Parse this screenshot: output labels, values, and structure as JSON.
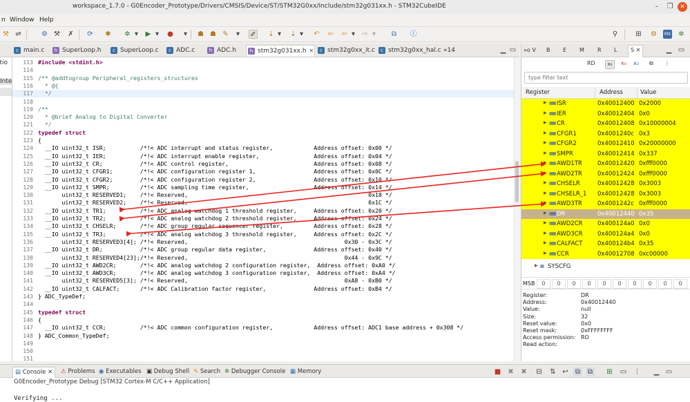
{
  "window": {
    "title": "workspace_1.7.0 - G0Encoder_Prototype/Drivers/CMSIS/Device/ST/STM32G0xx/Include/stm32g031xx.h - STM32CubeIDE",
    "min": "–",
    "max": "❐",
    "close": "✕"
  },
  "menu": {
    "items": [
      "n",
      "Window",
      "Help"
    ]
  },
  "toolbar": {
    "icons": [
      "wrench-icon",
      "debug-config-icon",
      "build-icon",
      "debug-icon",
      "run-icon",
      "external-tools-icon",
      "pin-icon",
      "step-icon",
      "back-icon",
      "forward-icon",
      "info-icon",
      "search-icon",
      "perspective-icon"
    ]
  },
  "editor_tabs": [
    {
      "label": "main.c",
      "icon_color": "#3a6ea5",
      "icon": "c"
    },
    {
      "label": "SuperLoop.h",
      "icon_color": "#8a6bb5",
      "icon": "h"
    },
    {
      "label": "SuperLoop.c",
      "icon_color": "#3a6ea5",
      "icon": "c"
    },
    {
      "label": "ADC.c",
      "icon_color": "#3a6ea5",
      "icon": "c"
    },
    {
      "label": "ADC.h",
      "icon_color": "#8a6bb5",
      "icon": "h"
    },
    {
      "label": "stm32g031xx.h",
      "icon_color": "#8a6bb5",
      "icon": "h",
      "close": "✕"
    },
    {
      "label": "stm32g0xx_it.c",
      "icon_color": "#3a6ea5",
      "icon": "c"
    },
    {
      "label": "stm32g0xx_hal.c",
      "icon_color": "#3a6ea5",
      "icon": "c"
    },
    {
      "label": "»14",
      "icon_color": "",
      "icon": ""
    }
  ],
  "left_panel": {
    "lines": [
      "atio",
      "Inte"
    ]
  },
  "code": [
    {
      "n": "113",
      "t": "#include <stdint.h>",
      "c": "include"
    },
    {
      "n": "114",
      "t": "",
      "c": ""
    },
    {
      "n": "115",
      "t": "/** @addtogroup Peripheral_registers_structures",
      "c": "comment"
    },
    {
      "n": "116",
      "t": "  * @{",
      "c": "comment"
    },
    {
      "n": "117",
      "t": "  */",
      "c": "comment"
    },
    {
      "n": "118",
      "t": "",
      "c": ""
    },
    {
      "n": "119",
      "t": "/**",
      "c": "comment"
    },
    {
      "n": "120",
      "t": "  * @brief Analog to Digital Converter",
      "c": "comment"
    },
    {
      "n": "121",
      "t": "  */",
      "c": "comment"
    },
    {
      "n": "122",
      "t": "typedef struct",
      "c": "keyword"
    },
    {
      "n": "123",
      "t": "{",
      "c": ""
    },
    {
      "n": "124",
      "t": "  __IO uint32_t ISR;          /*!< ADC interrupt and status register,            Address offset: 0x00 */",
      "c": ""
    },
    {
      "n": "125",
      "t": "  __IO uint32_t IER;          /*!< ADC interrupt enable register,                Address offset: 0x04 */",
      "c": ""
    },
    {
      "n": "126",
      "t": "  __IO uint32_t CR;           /*!< ADC control register,                         Address offset: 0x08 */",
      "c": ""
    },
    {
      "n": "127",
      "t": "  __IO uint32_t CFGR1;        /*!< ADC configuration register 1,                 Address offset: 0x0C */",
      "c": ""
    },
    {
      "n": "128",
      "t": "  __IO uint32_t CFGR2;        /*!< ADC configuration register 2,                 Address offset: 0x10 */",
      "c": ""
    },
    {
      "n": "129",
      "t": "  __IO uint32_t SMPR;         /*!< ADC sampling time register,                   Address offset: 0x14 */",
      "c": ""
    },
    {
      "n": "130",
      "t": "       uint32_t RESERVED1;    /*!< Reserved,                                                     0x18 */",
      "c": ""
    },
    {
      "n": "131",
      "t": "       uint32_t RESERVED2;    /*!< Reserved,                                                     0x1C */",
      "c": ""
    },
    {
      "n": "132",
      "t": "  __IO uint32_t TR1;          /*!< ADC analog watchdog 1 threshold register,     Address offset: 0x20 */",
      "c": ""
    },
    {
      "n": "133",
      "t": "  __IO uint32_t TR2;          /*!< ADC analog watchdog 2 threshold register,     Address offset: 0x24 */",
      "c": ""
    },
    {
      "n": "134",
      "t": "  __IO uint32_t CHSELR;       /*!< ADC group regular sequencer register,         Address offset: 0x28 */",
      "c": ""
    },
    {
      "n": "135",
      "t": "  __IO uint32_t TR3;          /*!< ADC analog watchdog 3 threshold register,     Address offset: 0x2C */",
      "c": ""
    },
    {
      "n": "136",
      "t": "       uint32_t RESERVED3[4]; /*!< Reserved,                                              0x30 - 0x3C */",
      "c": ""
    },
    {
      "n": "137",
      "t": "  __IO uint32_t DR;           /*!< ADC group regular data register,              Address offset: 0x40 */",
      "c": ""
    },
    {
      "n": "138",
      "t": "       uint32_t RESERVED4[23];/*!< Reserved,                                              0x44 - 0x9C */",
      "c": ""
    },
    {
      "n": "139",
      "t": "  __IO uint32_t AWD2CR;       /*!< ADC analog watchdog 2 configuration register,  Address offset: 0xA0 */",
      "c": ""
    },
    {
      "n": "140",
      "t": "  __IO uint32_t AWD3CR;       /*!< ADC analog watchdog 3 configuration register,  Address offset: 0xA4 */",
      "c": ""
    },
    {
      "n": "141",
      "t": "       uint32_t RESERVED5[3]; /*!< Reserved,                                              0xA8 - 0xB0 */",
      "c": ""
    },
    {
      "n": "142",
      "t": "  __IO uint32_t CALFACT;      /*!< ADC Calibration factor register,              Address offset: 0xB4 */",
      "c": ""
    },
    {
      "n": "143",
      "t": "} ADC_TypeDef;",
      "c": ""
    },
    {
      "n": "144",
      "t": "",
      "c": ""
    },
    {
      "n": "145",
      "t": "typedef struct",
      "c": "keyword"
    },
    {
      "n": "146",
      "t": "{",
      "c": ""
    },
    {
      "n": "147",
      "t": "  __IO uint32_t CCR;          /*!< ADC common configuration register,            Address offset: ADC1 base address + 0x308 */",
      "c": ""
    },
    {
      "n": "148",
      "t": "} ADC_Common_TypeDef;",
      "c": ""
    },
    {
      "n": "149",
      "t": "",
      "c": ""
    },
    {
      "n": "150",
      "t": "",
      "c": ""
    },
    {
      "n": "151",
      "t": "",
      "c": ""
    }
  ],
  "right_panel": {
    "tabs": [
      "«o V",
      "B",
      "E",
      "M",
      "R",
      "L",
      "S"
    ],
    "active_tab": "S",
    "tool_rd": "RD",
    "tool_x": "x₆",
    "tool_x0": "x₀",
    "tool_x2": "x₂",
    "filter_placeholder": "type filter text",
    "col_register": "Register",
    "col_address": "Address",
    "col_value": "Value",
    "registers": [
      {
        "name": "ISR",
        "address": "0x40012400",
        "value": "0x2000",
        "selected": false
      },
      {
        "name": "IER",
        "address": "0x40012404",
        "value": "0x0",
        "selected": false
      },
      {
        "name": "CR",
        "address": "0x40012408",
        "value": "0x10000004",
        "selected": false
      },
      {
        "name": "CFGR1",
        "address": "0x4001240c",
        "value": "0x3",
        "selected": false
      },
      {
        "name": "CFGR2",
        "address": "0x40012410",
        "value": "0x20000000",
        "selected": false
      },
      {
        "name": "SMPR",
        "address": "0x40012414",
        "value": "0x337",
        "selected": false
      },
      {
        "name": "AWD1TR",
        "address": "0x40012420",
        "value": "0xfff0000",
        "selected": false
      },
      {
        "name": "AWD2TR",
        "address": "0x40012424",
        "value": "0xfff0000",
        "selected": false
      },
      {
        "name": "CHSELR",
        "address": "0x40012428",
        "value": "0x3003",
        "selected": false
      },
      {
        "name": "CHSELR_1",
        "address": "0x40012428",
        "value": "0x3003",
        "selected": false
      },
      {
        "name": "AWD3TR",
        "address": "0x4001242c",
        "value": "0xfff0000",
        "selected": false
      },
      {
        "name": "DR",
        "address": "0x40012440",
        "value": "0x35",
        "selected": true
      },
      {
        "name": "AWD2CR",
        "address": "0x400124a0",
        "value": "0x0",
        "selected": false
      },
      {
        "name": "AWD3CR",
        "address": "0x400124a4",
        "value": "0x0",
        "selected": false
      },
      {
        "name": "CALFACT",
        "address": "0x400124b4",
        "value": "0x35",
        "selected": false
      },
      {
        "name": "CCR",
        "address": "0x40012708",
        "value": "0xc00000",
        "selected": false
      }
    ],
    "syscfg": "SYSCFG",
    "msb_label": "MSB",
    "bits": [
      "0",
      "0",
      "0",
      "0",
      "0",
      "0",
      "0",
      "0",
      "0",
      "0"
    ],
    "info": [
      {
        "k": "Register:",
        "v": "DR"
      },
      {
        "k": "Address:",
        "v": "0x40012440"
      },
      {
        "k": "Value:",
        "v": "null"
      },
      {
        "k": "Size:",
        "v": "32"
      },
      {
        "k": "Reset value:",
        "v": "0x0"
      },
      {
        "k": "Reset mask:",
        "v": "0xFFFFFFFF"
      },
      {
        "k": "Access permission:",
        "v": "RO"
      },
      {
        "k": "Read action:",
        "v": ""
      }
    ]
  },
  "bottom": {
    "tabs": [
      "Console ✕",
      "Problems",
      "Executables",
      "Debug Shell",
      "Search",
      "Debugger Console",
      "Memory"
    ],
    "console_title": "G0Encoder_Prototype Debug [STM32 Cortex-M C/C++ Application]",
    "console_text": "Verifying ..."
  },
  "colors": {
    "highlight": "#ffff00",
    "selected": "#c8b28c",
    "arrow": "#e8231c"
  }
}
